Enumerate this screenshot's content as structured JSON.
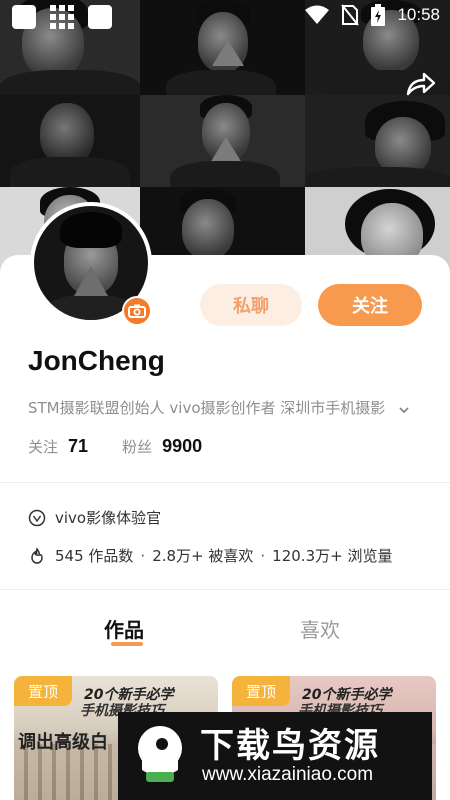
{
  "status_bar": {
    "time": "10:58"
  },
  "profile": {
    "username": "JonCheng",
    "bio": "STM摄影联盟创始人 vivo摄影创作者 深圳市手机摄影",
    "message_button": "私聊",
    "follow_button": "关注",
    "following_label": "关注",
    "following_count": "71",
    "followers_label": "粉丝",
    "followers_count": "9900"
  },
  "info": {
    "badge_text": "vivo影像体验官",
    "works_stat": "545 作品数",
    "likes_stat": "2.8万+ 被喜欢",
    "views_stat": "120.3万+ 浏览量",
    "separator": "·"
  },
  "tabs": {
    "works": "作品",
    "likes": "喜欢"
  },
  "works": [
    {
      "pin": "置顶",
      "title_line1": "20个新手必学",
      "title_line2": "手机摄影技巧",
      "subtitle": "调出高级白"
    },
    {
      "pin": "置顶",
      "title_line1": "20个新手必学",
      "title_line2": "手机摄影技巧",
      "subtitle": ""
    }
  ],
  "watermark": {
    "title": "下载鸟资源",
    "url": "www.xiazainiao.com"
  },
  "colors": {
    "accent": "#f79a4e",
    "accent_light": "#fdeee3",
    "pin": "#f6b33c",
    "camera_badge": "#f57b2a"
  }
}
